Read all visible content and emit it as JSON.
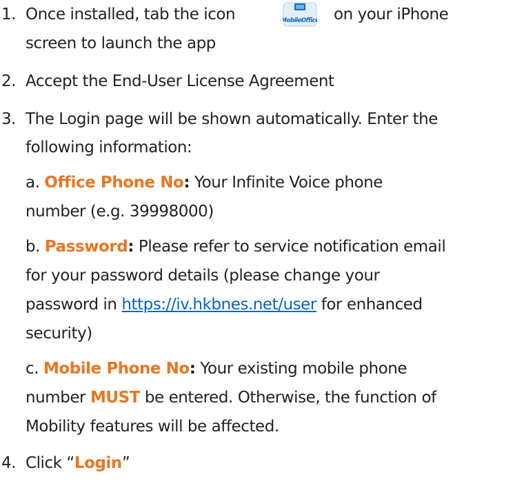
{
  "steps": [
    {
      "num": "1.",
      "line1_before_icon": "Once installed, tab the icon",
      "line1_after_icon": "on your iPhone",
      "line2": "screen to launch the app"
    },
    {
      "num": "2.",
      "text": "Accept the End-User License Agreement"
    },
    {
      "num": "3.",
      "line1": "The Login page will be shown automatically. Enter the",
      "line2": "following information:"
    },
    {
      "num": "4.",
      "before": "Click “",
      "label": "Login",
      "after": "”"
    }
  ],
  "fields": {
    "a": {
      "prefix": "a.",
      "label": "Office Phone No",
      "colon": ":",
      "line1": "Your Infinite Voice phone",
      "line2": "number (e.g. 39998000)"
    },
    "b": {
      "prefix": "b.",
      "label": "Password",
      "colon": ":",
      "line1": "Please refer to service notification email",
      "line2": "for your password details (please change your",
      "line3_before": "password in",
      "link": "https://iv.hkbnes.net/user",
      "line3_after": "for enhanced",
      "line4": "security)"
    },
    "c": {
      "prefix": "c.",
      "label": "Mobile Phone No",
      "colon": ":",
      "line1": "Your existing mobile phone",
      "line2_before": "number",
      "must": "MUST",
      "line2_after": "be entered. Otherwise, the function of",
      "line3": "Mobility features will be affected."
    }
  },
  "app_icon": {
    "icon": "mobileoffice-app-icon",
    "text": "MobileOffice",
    "accent": "#E87722",
    "brand": "#1565C0",
    "badge_bg": "#E3F0FB"
  }
}
